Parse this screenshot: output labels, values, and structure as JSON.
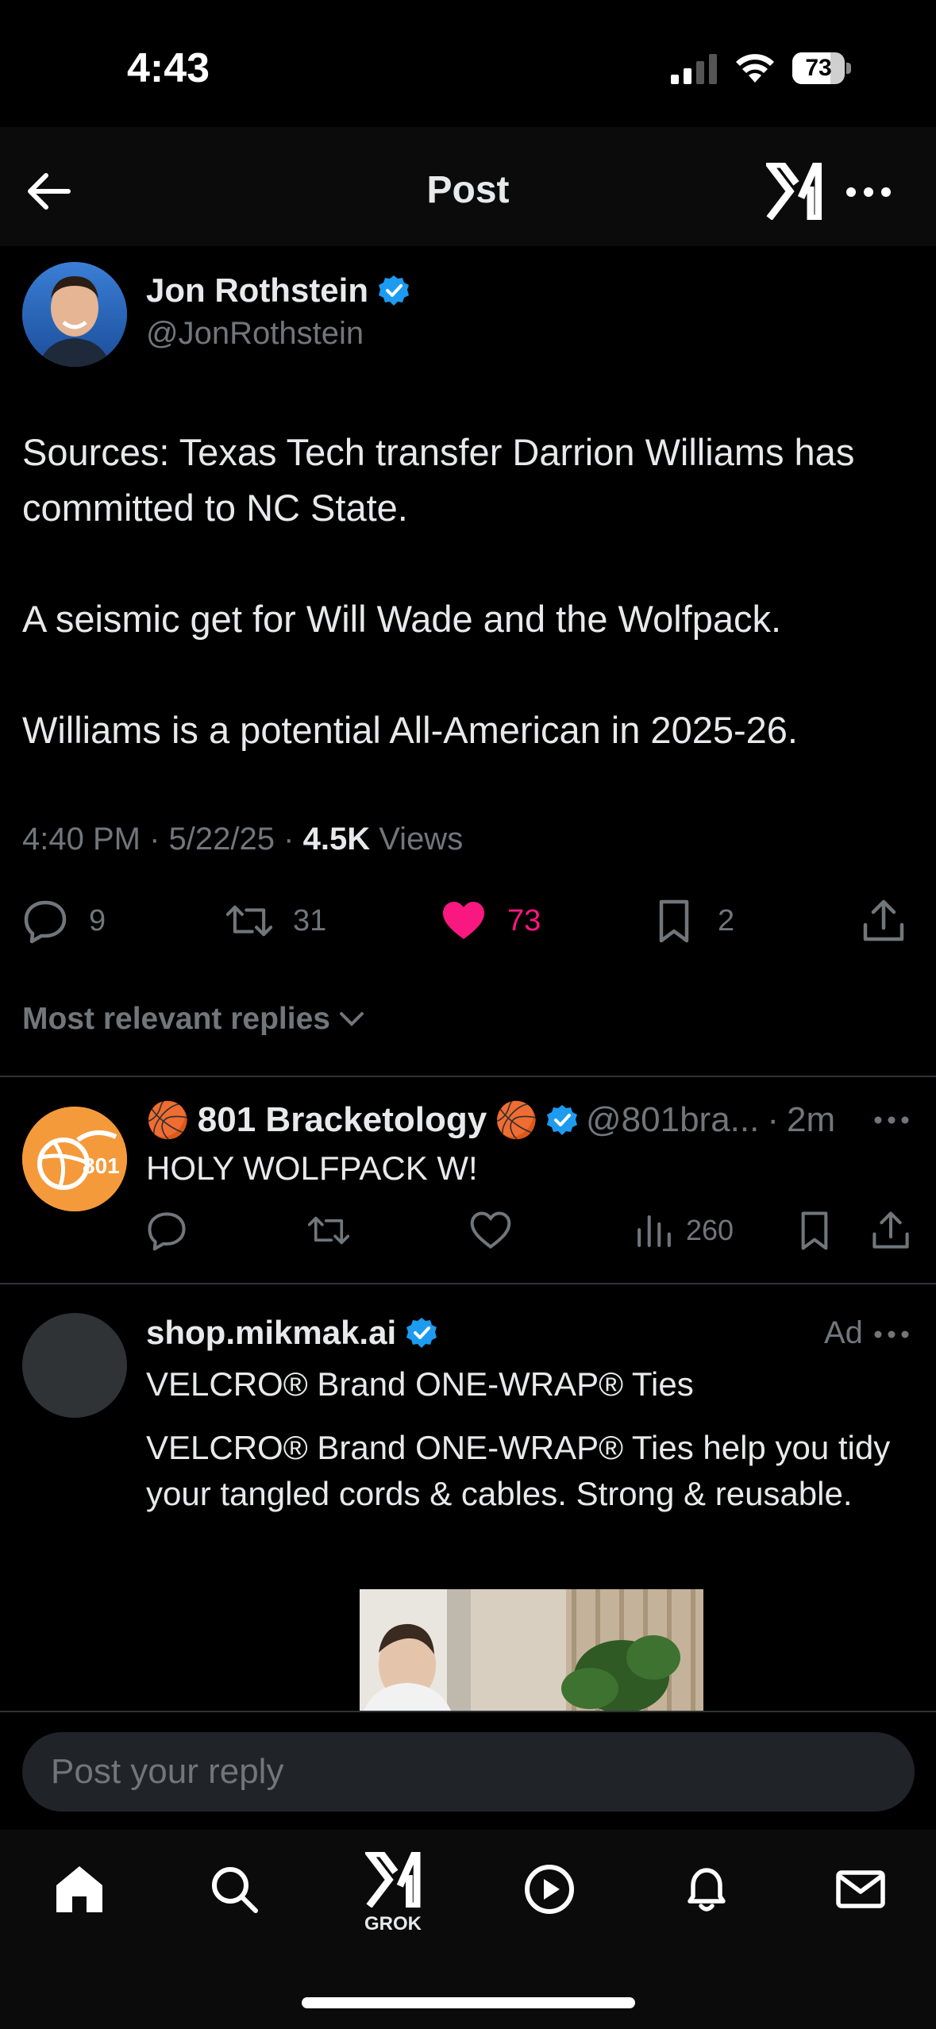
{
  "status_bar": {
    "time": "4:43",
    "battery_level": "73",
    "battery_fraction": 0.73
  },
  "header": {
    "title": "Post"
  },
  "post": {
    "author": {
      "name": "Jon Rothstein",
      "handle": "@JonRothstein"
    },
    "paragraphs": [
      "Sources: Texas Tech transfer Darrion Williams has committed to NC State.",
      "A seismic get for Will Wade and the Wolfpack.",
      "Williams is a potential All-American in 2025-26."
    ],
    "time": "4:40 PM",
    "date": "5/22/25",
    "views_count": "4.5K",
    "views_label": "Views",
    "sep": "·",
    "actions": {
      "replies": "9",
      "reposts": "31",
      "likes": "73",
      "bookmarks": "2"
    },
    "like_color": "#f91880"
  },
  "replies_filter": {
    "label": "Most relevant replies"
  },
  "reply": {
    "emoji_left": "🏀",
    "name": "801 Bracketology",
    "emoji_right": "🏀",
    "handle": "@801bra...",
    "time_sep": "·",
    "time": "2m",
    "avatar_text": "801",
    "text": "HOLY WOLFPACK W!",
    "views": "260"
  },
  "ad": {
    "name": "shop.mikmak.ai",
    "label": "Ad",
    "title": "VELCRO® Brand ONE-WRAP® Ties",
    "description": "VELCRO® Brand ONE-WRAP® Ties help you tidy your tangled cords & cables. Strong & reusable."
  },
  "reply_bar": {
    "placeholder": "Post your reply"
  },
  "tabbar": {
    "grok_label": "GROK"
  },
  "colors": {
    "verified": "#1d9bf0",
    "muted": "#71767b",
    "text": "#e7e9ea"
  }
}
